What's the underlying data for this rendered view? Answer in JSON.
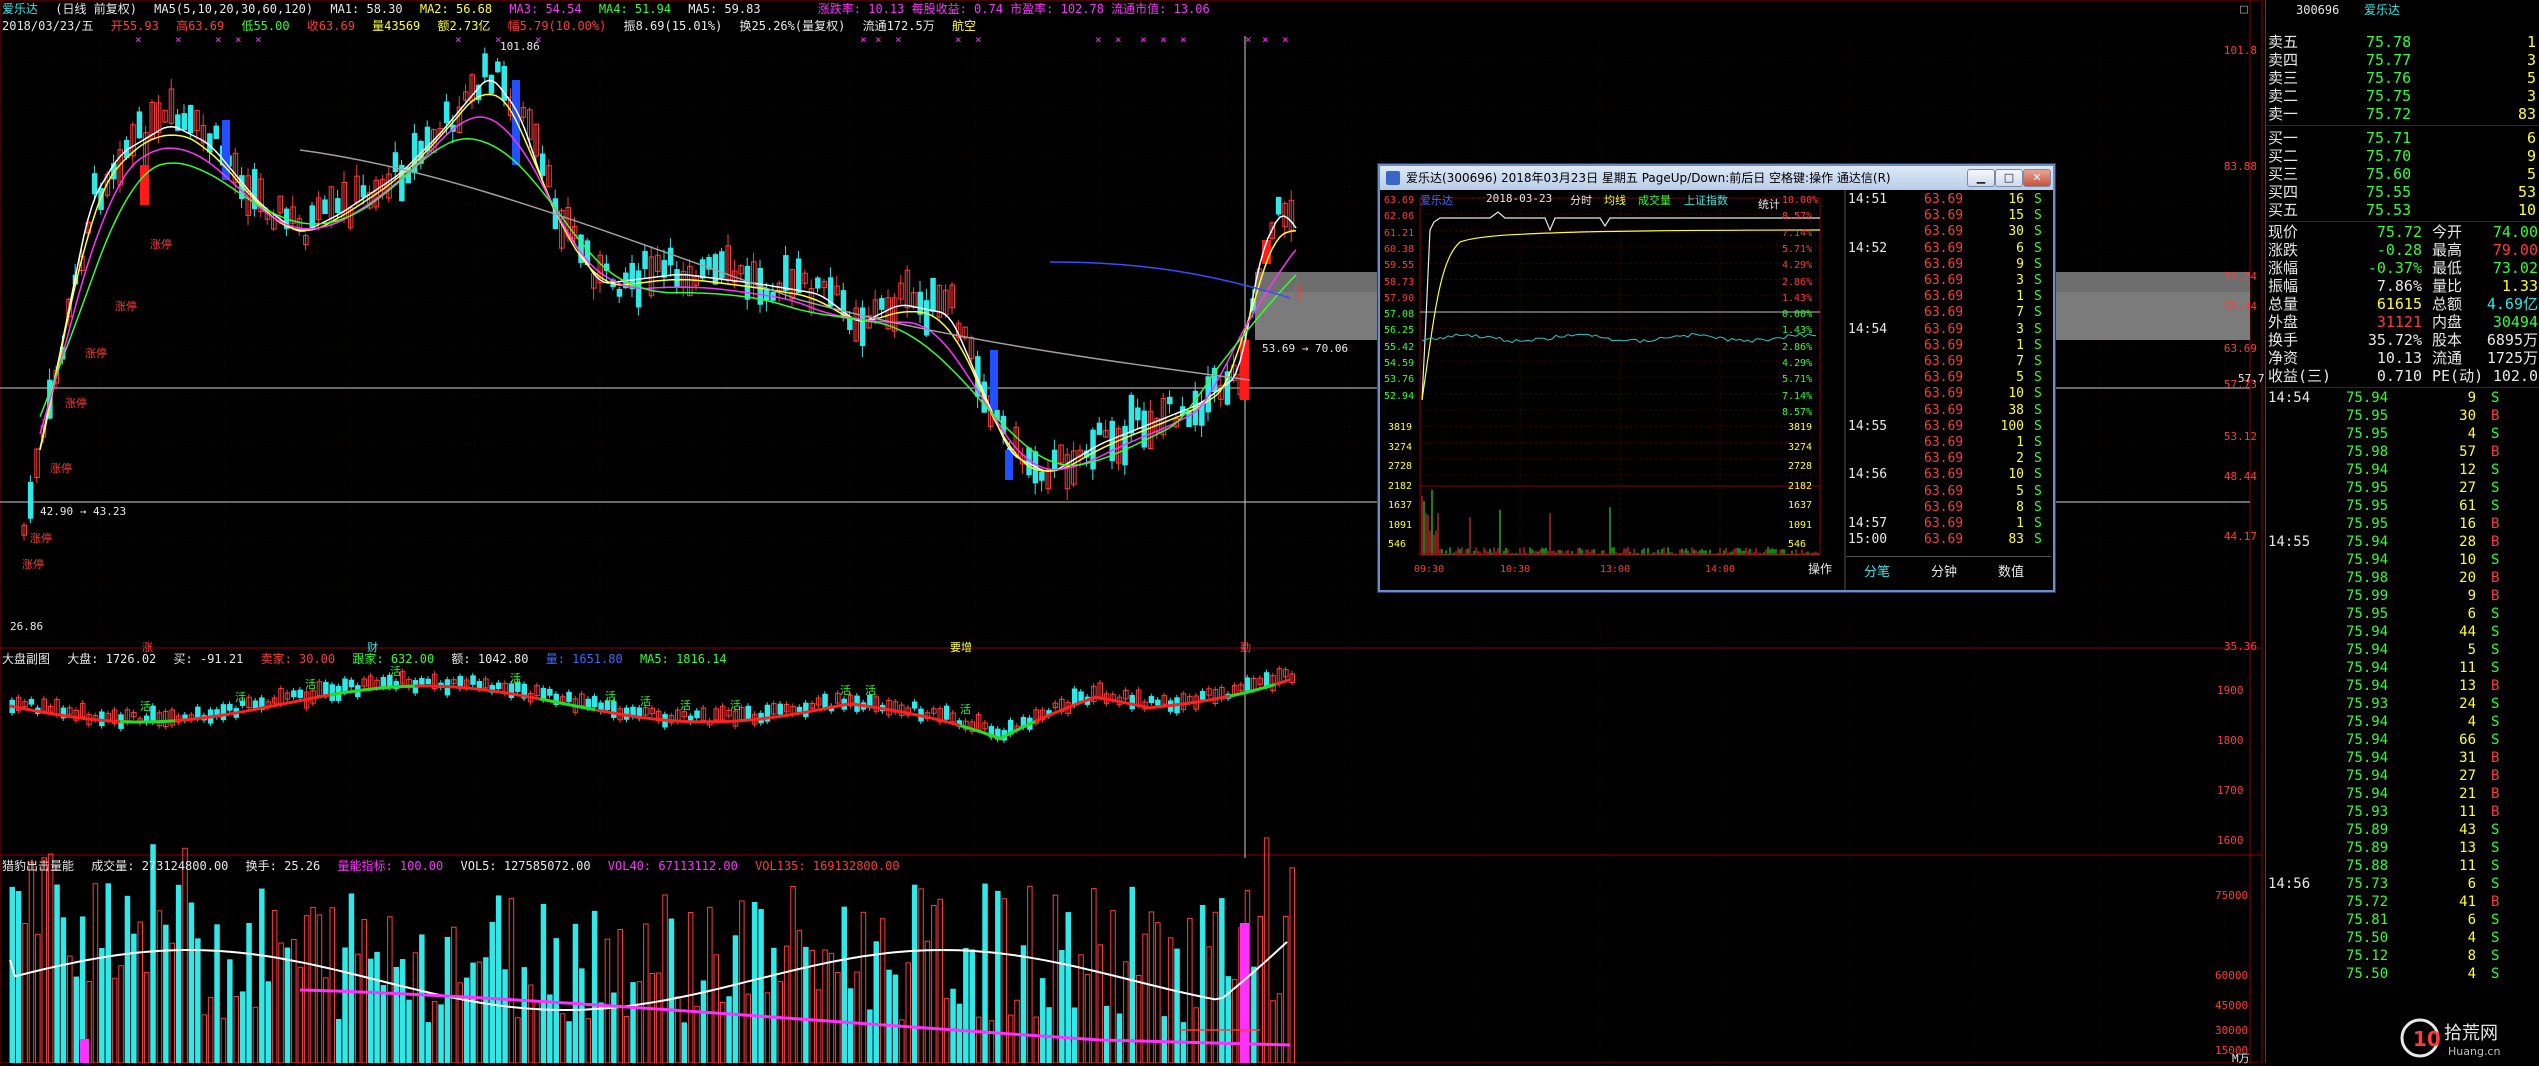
{
  "main_header": {
    "stock": "爱乐达",
    "period": "(日线 前复权)",
    "ma_params": "MA5(5,10,20,30,60,120)",
    "ma1": "MA1: 58.30",
    "ma2": "MA2: 56.68",
    "ma3": "MA3: 54.54",
    "ma4": "MA4: 51.94",
    "ma5": "MA5: 59.83",
    "extra": "涨跌率: 10.13 每股收益: 0.74 市盈率: 102.78 流通市值: 13.06"
  },
  "info_line": {
    "date": "2018/03/23/五",
    "open": "开55.93",
    "high": "高63.69",
    "low": "低55.00",
    "close": "收63.69",
    "volume": "量43569",
    "amount": "额2.73亿",
    "change": "幅5.79(10.00%)",
    "amp": "振8.69(15.01%)",
    "turnover": "换25.26%(量复权)",
    "float": "流通172.5万",
    "short": "航空"
  },
  "price_axis_labels": [
    "101.8",
    "83.88",
    "76.24",
    "68.44",
    "63.69",
    "57.73",
    "53.12",
    "48.44",
    "44.17",
    "35.36"
  ],
  "price_annotations": {
    "high_label": "101.86",
    "low_label": "26.86",
    "left_line_label": "42.90 → 43.23",
    "right_line_label": "53.69 → 70.06",
    "yline_value": "57.73"
  },
  "red_markers": [
    "涨停",
    "涨停",
    "涨停",
    "涨停",
    "涨停",
    "涨停",
    "涨停"
  ],
  "event_markers": [
    "涨",
    "财",
    "要增",
    "勤"
  ],
  "mid_header": {
    "name": "大盘副图",
    "dapan": "大盘: 1726.02",
    "buy": "买: -91.21",
    "sell": "卖家: 30.00",
    "follow": "跟家: 632.00",
    "amount": "额: 1042.80",
    "lb": "量: 1651.80",
    "ma5": "MA5: 1816.14"
  },
  "mid_axis_labels": [
    "1900",
    "1800",
    "1700",
    "1600"
  ],
  "mid_tags": [
    "活",
    "活",
    "活",
    "活",
    "活",
    "活",
    "活",
    "活",
    "活",
    "活",
    "活",
    "活"
  ],
  "vol_header": {
    "name": "猎豹出击量能",
    "vol": "成交量: 273124800.00",
    "turnover": "换手: 25.26",
    "flag": "量能指标: 100.00",
    "vol5": "VOL5: 127585072.00",
    "vol40": "VOL40: 67113112.00",
    "vol135": "VOL135: 169132800.00"
  },
  "vol_axis_labels": [
    "75000",
    "60000",
    "45000",
    "30000",
    "15000"
  ],
  "bottom_right_tag": "M万",
  "right_panel": {
    "code": "300696",
    "name": "爱乐达",
    "asks": [
      {
        "label": "卖五",
        "price": "75.78",
        "vol": "1"
      },
      {
        "label": "卖四",
        "price": "75.77",
        "vol": "3"
      },
      {
        "label": "卖三",
        "price": "75.76",
        "vol": "5"
      },
      {
        "label": "卖二",
        "price": "75.75",
        "vol": "3"
      },
      {
        "label": "卖一",
        "price": "75.72",
        "vol": "83"
      }
    ],
    "bids": [
      {
        "label": "买一",
        "price": "75.71",
        "vol": "6"
      },
      {
        "label": "买二",
        "price": "75.70",
        "vol": "9"
      },
      {
        "label": "买三",
        "price": "75.60",
        "vol": "5"
      },
      {
        "label": "买四",
        "price": "75.55",
        "vol": "53"
      },
      {
        "label": "买五",
        "price": "75.53",
        "vol": "10"
      }
    ],
    "stats": [
      {
        "l1": "现价",
        "v1": "75.72",
        "l2": "今开",
        "v2": "74.00",
        "c1": "green",
        "c2": "green"
      },
      {
        "l1": "涨跌",
        "v1": "-0.28",
        "l2": "最高",
        "v2": "79.00",
        "c1": "green",
        "c2": "red"
      },
      {
        "l1": "涨幅",
        "v1": "-0.37%",
        "l2": "最低",
        "v2": "73.02",
        "c1": "green",
        "c2": "green"
      },
      {
        "l1": "振幅",
        "v1": "7.86%",
        "l2": "量比",
        "v2": "1.33",
        "c1": "white",
        "c2": "yellow"
      },
      {
        "l1": "总量",
        "v1": "61615",
        "l2": "总额",
        "v2": "4.69亿",
        "c1": "yellow",
        "c2": "cyan"
      },
      {
        "l1": "外盘",
        "v1": "31121",
        "l2": "内盘",
        "v2": "30494",
        "c1": "red",
        "c2": "green"
      },
      {
        "l1": "换手",
        "v1": "35.72%",
        "l2": "股本",
        "v2": "6895万",
        "c1": "white",
        "c2": "white"
      },
      {
        "l1": "净资",
        "v1": "10.13",
        "l2": "流通",
        "v2": "1725万",
        "c1": "white",
        "c2": "white"
      },
      {
        "l1": "收益(三)",
        "v1": "0.710",
        "l2": "PE(动)",
        "v2": "102.0",
        "c1": "white",
        "c2": "white"
      }
    ],
    "ticks": [
      {
        "t": "14:54",
        "p": "75.94",
        "v": "9",
        "d": "S"
      },
      {
        "t": "",
        "p": "75.95",
        "v": "30",
        "d": "B"
      },
      {
        "t": "",
        "p": "75.95",
        "v": "4",
        "d": "S"
      },
      {
        "t": "",
        "p": "75.98",
        "v": "57",
        "d": "B"
      },
      {
        "t": "",
        "p": "75.94",
        "v": "12",
        "d": "S"
      },
      {
        "t": "",
        "p": "75.95",
        "v": "27",
        "d": "S"
      },
      {
        "t": "",
        "p": "75.95",
        "v": "61",
        "d": "S"
      },
      {
        "t": "",
        "p": "75.95",
        "v": "16",
        "d": "B"
      },
      {
        "t": "14:55",
        "p": "75.94",
        "v": "28",
        "d": "B"
      },
      {
        "t": "",
        "p": "75.94",
        "v": "10",
        "d": "S"
      },
      {
        "t": "",
        "p": "75.98",
        "v": "20",
        "d": "B"
      },
      {
        "t": "",
        "p": "75.99",
        "v": "9",
        "d": "B"
      },
      {
        "t": "",
        "p": "75.95",
        "v": "6",
        "d": "S"
      },
      {
        "t": "",
        "p": "75.94",
        "v": "44",
        "d": "S"
      },
      {
        "t": "",
        "p": "75.94",
        "v": "5",
        "d": "S"
      },
      {
        "t": "",
        "p": "75.94",
        "v": "11",
        "d": "S"
      },
      {
        "t": "",
        "p": "75.94",
        "v": "13",
        "d": "B"
      },
      {
        "t": "",
        "p": "75.93",
        "v": "24",
        "d": "S"
      },
      {
        "t": "",
        "p": "75.94",
        "v": "4",
        "d": "S"
      },
      {
        "t": "",
        "p": "75.94",
        "v": "66",
        "d": "S"
      },
      {
        "t": "",
        "p": "75.94",
        "v": "31",
        "d": "B"
      },
      {
        "t": "",
        "p": "75.94",
        "v": "27",
        "d": "B"
      },
      {
        "t": "",
        "p": "75.94",
        "v": "21",
        "d": "B"
      },
      {
        "t": "",
        "p": "75.93",
        "v": "11",
        "d": "B"
      },
      {
        "t": "",
        "p": "75.89",
        "v": "43",
        "d": "S"
      },
      {
        "t": "",
        "p": "75.89",
        "v": "13",
        "d": "S"
      },
      {
        "t": "",
        "p": "75.88",
        "v": "11",
        "d": "S"
      },
      {
        "t": "14:56",
        "p": "75.73",
        "v": "6",
        "d": "S"
      },
      {
        "t": "",
        "p": "75.72",
        "v": "41",
        "d": "B"
      },
      {
        "t": "",
        "p": "75.81",
        "v": "6",
        "d": "S"
      },
      {
        "t": "",
        "p": "75.50",
        "v": "4",
        "d": "S"
      },
      {
        "t": "",
        "p": "75.12",
        "v": "8",
        "d": "S"
      },
      {
        "t": "",
        "p": "75.50",
        "v": "4",
        "d": "S"
      }
    ]
  },
  "popup": {
    "title": "爱乐达(300696) 2018年03月23日 星期五 PageUp/Down:前后日 空格键:操作 通达信(R)",
    "tab_name": "爱乐达",
    "date": "2018-03-23",
    "legend": [
      "分时",
      "均线",
      "成交量",
      "上证指数"
    ],
    "stat_label": "统计",
    "left_axis": [
      "63.69",
      "62.06",
      "61.21",
      "60.38",
      "59.55",
      "58.73",
      "57.90",
      "57.08",
      "56.25",
      "55.42",
      "54.59",
      "53.76",
      "52.94"
    ],
    "right_axis": [
      "10.00%",
      "8.57%",
      "7.14%",
      "5.71%",
      "4.29%",
      "2.86%",
      "1.43%",
      "0.00%",
      "1.43%",
      "2.86%",
      "4.29%",
      "5.71%",
      "7.14%",
      "8.57%"
    ],
    "vol_axis": [
      "3819",
      "3274",
      "2728",
      "2182",
      "1637",
      "1091",
      "546"
    ],
    "x_axis": [
      "09:30",
      "10:30",
      "13:00",
      "14:00"
    ],
    "op_label": "操作",
    "trades": [
      {
        "t": "14:51",
        "p": "63.69",
        "v": "16",
        "d": "S"
      },
      {
        "t": "",
        "p": "63.69",
        "v": "15",
        "d": "S"
      },
      {
        "t": "",
        "p": "63.69",
        "v": "30",
        "d": "S"
      },
      {
        "t": "14:52",
        "p": "63.69",
        "v": "6",
        "d": "S"
      },
      {
        "t": "",
        "p": "63.69",
        "v": "9",
        "d": "S"
      },
      {
        "t": "",
        "p": "63.69",
        "v": "3",
        "d": "S"
      },
      {
        "t": "",
        "p": "63.69",
        "v": "1",
        "d": "S"
      },
      {
        "t": "",
        "p": "63.69",
        "v": "7",
        "d": "S"
      },
      {
        "t": "14:54",
        "p": "63.69",
        "v": "3",
        "d": "S"
      },
      {
        "t": "",
        "p": "63.69",
        "v": "1",
        "d": "S"
      },
      {
        "t": "",
        "p": "63.69",
        "v": "7",
        "d": "S"
      },
      {
        "t": "",
        "p": "63.69",
        "v": "5",
        "d": "S"
      },
      {
        "t": "",
        "p": "63.69",
        "v": "10",
        "d": "S"
      },
      {
        "t": "",
        "p": "63.69",
        "v": "38",
        "d": "S"
      },
      {
        "t": "14:55",
        "p": "63.69",
        "v": "100",
        "d": "S"
      },
      {
        "t": "",
        "p": "63.69",
        "v": "1",
        "d": "S"
      },
      {
        "t": "",
        "p": "63.69",
        "v": "2",
        "d": "S"
      },
      {
        "t": "14:56",
        "p": "63.69",
        "v": "10",
        "d": "S"
      },
      {
        "t": "",
        "p": "63.69",
        "v": "5",
        "d": "S"
      },
      {
        "t": "",
        "p": "63.69",
        "v": "8",
        "d": "S"
      },
      {
        "t": "14:57",
        "p": "63.69",
        "v": "1",
        "d": "S"
      },
      {
        "t": "15:00",
        "p": "63.69",
        "v": "83",
        "d": "S"
      }
    ],
    "bottom_tabs": [
      "分笔",
      "分钟",
      "数值"
    ]
  },
  "watermark": {
    "text": "拾荒网",
    "sub": "Huang.cn"
  },
  "colors": {
    "up": "#ff3b3b",
    "down": "#31e8e8",
    "ma_white": "#ffffff",
    "ma_yellow": "#ffff31",
    "ma_magenta": "#ff31ff",
    "ma_green": "#31ff31",
    "ma_gray": "#a0a0a0",
    "ma_blue": "#3b4bff"
  }
}
